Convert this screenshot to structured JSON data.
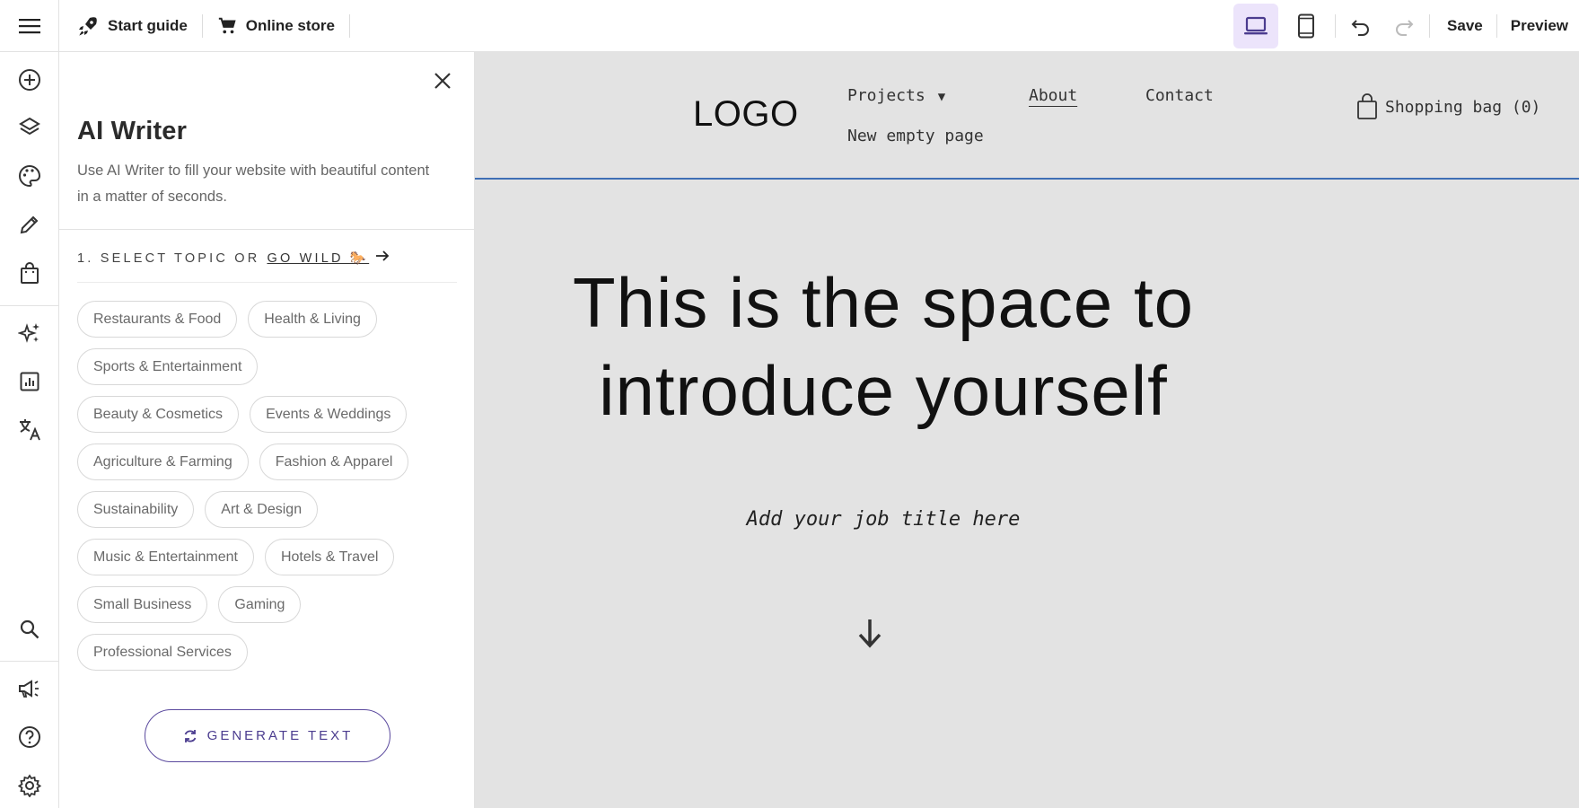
{
  "topbar": {
    "start_guide": "Start guide",
    "online_store": "Online store",
    "save": "Save",
    "preview": "Preview"
  },
  "rail": {
    "icons": [
      "add-icon",
      "layers-icon",
      "palette-icon",
      "pencil-icon",
      "shopping-bag-icon",
      "sparkle-icon",
      "analytics-icon",
      "translate-icon",
      "search-icon",
      "megaphone-icon",
      "help-icon",
      "settings-icon"
    ]
  },
  "panel": {
    "title": "AI Writer",
    "description": "Use AI Writer to fill your website with beautiful content in a matter of seconds.",
    "step_label": "1. SELECT TOPIC OR",
    "go_wild": "GO WILD 🐎",
    "topics": [
      [
        "Restaurants & Food",
        "Health & Living"
      ],
      [
        "Sports & Entertainment"
      ],
      [
        "Beauty & Cosmetics",
        "Events & Weddings"
      ],
      [
        "Agriculture & Farming",
        "Fashion & Apparel"
      ],
      [
        "Sustainability",
        "Art & Design"
      ],
      [
        "Music & Entertainment",
        "Hotels & Travel"
      ],
      [
        "Small Business",
        "Gaming"
      ],
      [
        "Professional Services"
      ]
    ],
    "generate_label": "GENERATE TEXT"
  },
  "site": {
    "logo": "LOGO",
    "nav_projects": "Projects",
    "nav_about": "About",
    "nav_contact": "Contact",
    "nav_new_page": "New empty page",
    "shopping_bag": "Shopping bag (0)",
    "hero_line1": "This is the space to",
    "hero_line2": "introduce yourself",
    "job_title": "Add your job title here"
  },
  "colors": {
    "accent": "#5b4a9e",
    "active_device_bg": "#ece4fb",
    "canvas_bg": "#e3e3e3",
    "header_line": "#3f6fb5"
  }
}
